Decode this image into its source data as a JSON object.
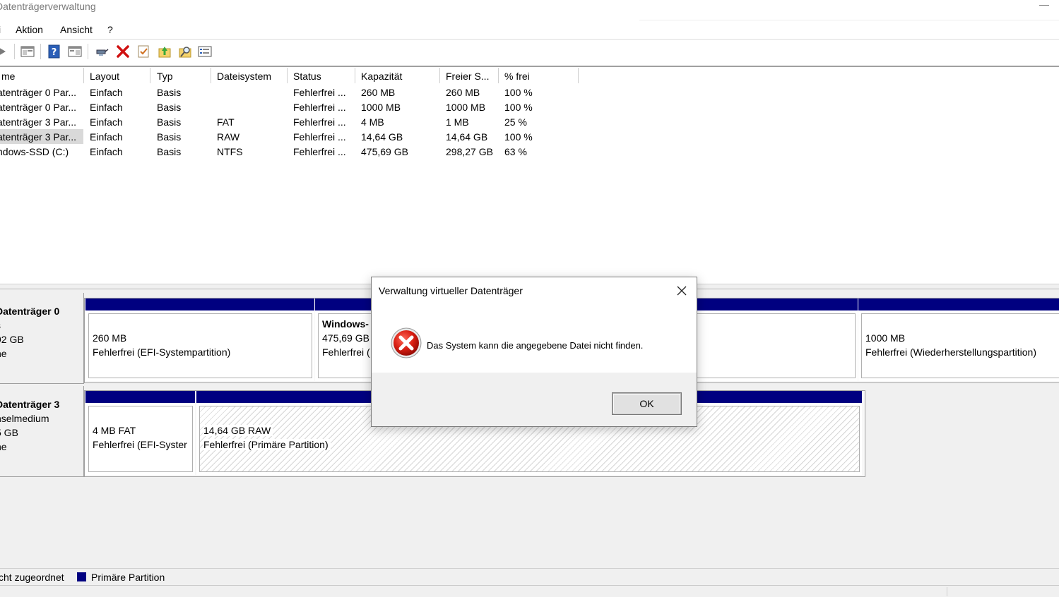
{
  "window": {
    "title": "Datenträgerverwaltung",
    "minimize_glyph": "—"
  },
  "menu": [
    "i",
    "Aktion",
    "Ansicht",
    "?"
  ],
  "toolbar": {
    "icons": [
      "back-arrow-icon",
      "console-tree-icon",
      "help-icon",
      "show-hide-pane-icon",
      "connect-drive-icon",
      "delete-icon",
      "check-icon",
      "folder-up-icon",
      "search-icon",
      "properties-icon"
    ]
  },
  "volume_list": {
    "columns": [
      "me",
      "Layout",
      "Typ",
      "Dateisystem",
      "Status",
      "Kapazität",
      "Freier S...",
      "% frei"
    ],
    "rows": [
      [
        "atenträger 0 Par...",
        "Einfach",
        "Basis",
        "",
        "Fehlerfrei ...",
        "260 MB",
        "260 MB",
        "100 %"
      ],
      [
        "atenträger 0 Par...",
        "Einfach",
        "Basis",
        "",
        "Fehlerfrei ...",
        "1000 MB",
        "1000 MB",
        "100 %"
      ],
      [
        "atenträger 3 Par...",
        "Einfach",
        "Basis",
        "FAT",
        "Fehlerfrei ...",
        "4 MB",
        "1 MB",
        "25 %"
      ],
      [
        "atenträger 3 Par...",
        "Einfach",
        "Basis",
        "RAW",
        "Fehlerfrei ...",
        "14,64 GB",
        "14,64 GB",
        "100 %"
      ],
      [
        "ndows-SSD (C:)",
        "Einfach",
        "Basis",
        "NTFS",
        "Fehlerfrei ...",
        "475,69 GB",
        "298,27 GB",
        "63 %"
      ]
    ]
  },
  "disks": [
    {
      "label": [
        "Datenträger 0",
        "s",
        "92 GB",
        "ne"
      ],
      "partitions": [
        {
          "line1": "260 MB",
          "line2": "Fehlerfrei (EFI-Systempartition)"
        },
        {
          "line1": "Windows-",
          "line1b": "475,69 GB",
          "line2": "Fehlerfrei ("
        },
        {
          "line1": "",
          "line2": ""
        },
        {
          "line1": "1000 MB",
          "line2": "Fehlerfrei (Wiederherstellungspartition)"
        }
      ]
    },
    {
      "label": [
        "Datenträger 3",
        "hselmedium",
        "5 GB",
        "ne"
      ],
      "partitions": [
        {
          "line1": "4 MB FAT",
          "line2": "Fehlerfrei (EFI-Syster"
        },
        {
          "line1": "14,64 GB RAW",
          "line2": "Fehlerfrei (Primäre Partition)"
        }
      ]
    }
  ],
  "legend": {
    "unallocated": "cht zugeordnet",
    "primary": "Primäre Partition",
    "primary_color": "#000080"
  },
  "dialog": {
    "title": "Verwaltung virtueller Datenträger",
    "message": "Das System kann die angegebene Datei nicht finden.",
    "ok_label": "OK",
    "icon": "error-icon"
  }
}
